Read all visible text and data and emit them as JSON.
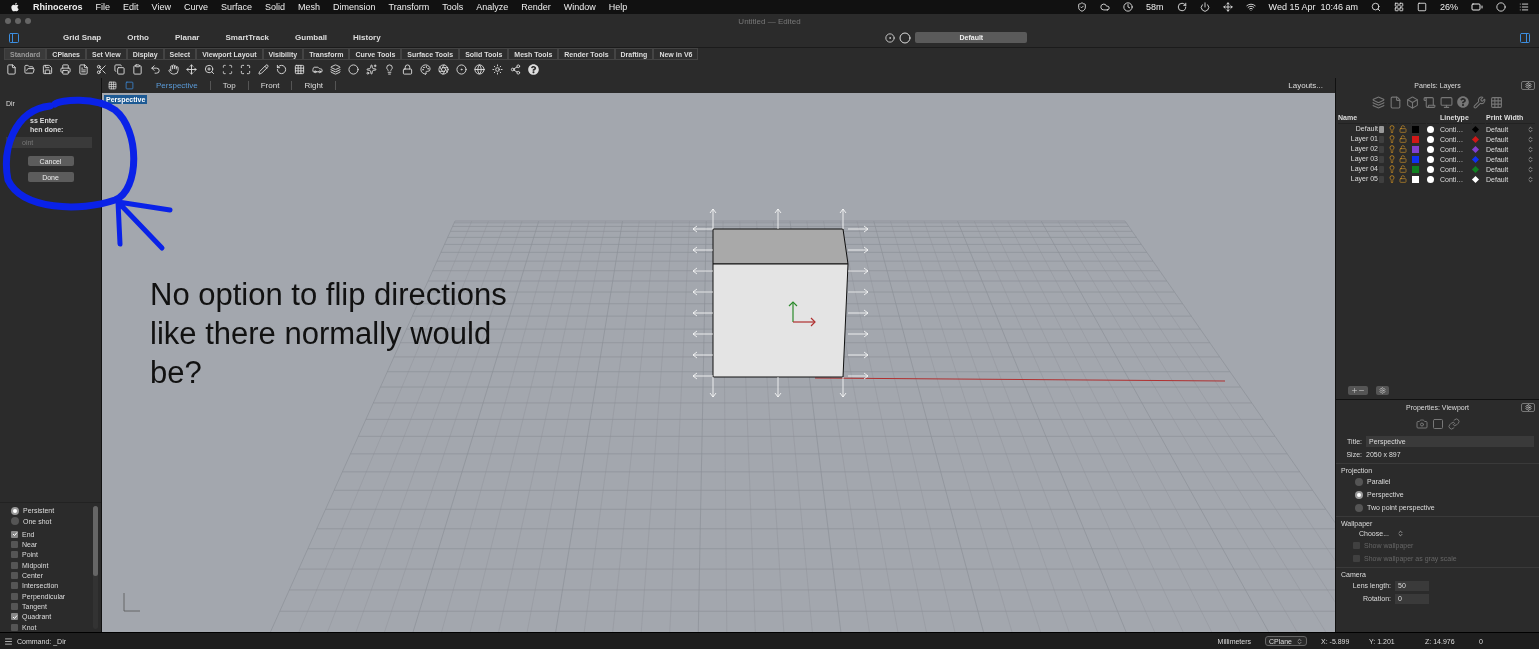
{
  "menu_bar": {
    "app": "Rhinoceros",
    "items": [
      "File",
      "Edit",
      "View",
      "Curve",
      "Surface",
      "Solid",
      "Mesh",
      "Dimension",
      "Transform",
      "Tools",
      "Analyze",
      "Render",
      "Window",
      "Help"
    ],
    "timer": "58m",
    "datetime": "Wed 15 Apr  10:46 am",
    "battery": "26%"
  },
  "window": {
    "title": "Untitled — Edited"
  },
  "modes": [
    "Grid Snap",
    "Ortho",
    "Planar",
    "SmartTrack",
    "Gumball",
    "History"
  ],
  "layer_field": "Default",
  "toolbar_tabs": [
    {
      "label": "Standard",
      "selected": true
    },
    {
      "label": "CPlanes",
      "selected": false
    },
    {
      "label": "Set View",
      "selected": false
    },
    {
      "label": "Display",
      "selected": false
    },
    {
      "label": "Select",
      "selected": false
    },
    {
      "label": "Viewport Layout",
      "selected": false
    },
    {
      "label": "Visibility",
      "selected": false
    },
    {
      "label": "Transform",
      "selected": false
    },
    {
      "label": "Curve Tools",
      "selected": false
    },
    {
      "label": "Surface Tools",
      "selected": false
    },
    {
      "label": "Solid Tools",
      "selected": false
    },
    {
      "label": "Mesh Tools",
      "selected": false
    },
    {
      "label": "Render Tools",
      "selected": false
    },
    {
      "label": "Drafting",
      "selected": false
    },
    {
      "label": "New in V6",
      "selected": false
    }
  ],
  "viewport_tabs": [
    {
      "label": "Perspective",
      "selected": true
    },
    {
      "label": "Top",
      "selected": false
    },
    {
      "label": "Front",
      "selected": false
    },
    {
      "label": "Right",
      "selected": false
    }
  ],
  "layouts_button": "Layouts...",
  "viewport": {
    "label": "Perspective"
  },
  "command_panel": {
    "title": "Dir",
    "prompt": [
      "ss Enter",
      "hen done:"
    ],
    "input": {
      "placeholder": "oint"
    },
    "buttons": [
      "Cancel",
      "Done"
    ]
  },
  "osnap": {
    "modes": [
      {
        "label": "Persistent",
        "selected": true
      },
      {
        "label": "One shot",
        "selected": false
      }
    ],
    "snaps": [
      {
        "label": "End",
        "checked": true
      },
      {
        "label": "Near",
        "checked": false
      },
      {
        "label": "Point",
        "checked": false
      },
      {
        "label": "Midpoint",
        "checked": false
      },
      {
        "label": "Center",
        "checked": false
      },
      {
        "label": "Intersection",
        "checked": false
      },
      {
        "label": "Perpendicular",
        "checked": false
      },
      {
        "label": "Tangent",
        "checked": false
      },
      {
        "label": "Quadrant",
        "checked": true
      },
      {
        "label": "Knot",
        "checked": false
      }
    ]
  },
  "annotation": {
    "text": "No option to flip directions like there normally would be?"
  },
  "layers_panel": {
    "title": "Panels: Layers",
    "columns": [
      "Name",
      "Linetype",
      "Print Width"
    ],
    "rows": [
      {
        "name": "Default",
        "current": true,
        "color": "#000000",
        "linetype": "Conti…",
        "print_width": "Default"
      },
      {
        "name": "Layer 01",
        "current": false,
        "color": "#d01818",
        "linetype": "Conti…",
        "print_width": "Default"
      },
      {
        "name": "Layer 02",
        "current": false,
        "color": "#8040d0",
        "linetype": "Conti…",
        "print_width": "Default"
      },
      {
        "name": "Layer 03",
        "current": false,
        "color": "#1030f0",
        "linetype": "Conti…",
        "print_width": "Default"
      },
      {
        "name": "Layer 04",
        "current": false,
        "color": "#108020",
        "linetype": "Conti…",
        "print_width": "Default"
      },
      {
        "name": "Layer 05",
        "current": false,
        "color": "#ffffff",
        "linetype": "Conti…",
        "print_width": "Default"
      }
    ]
  },
  "properties_panel": {
    "title": "Properties: Viewport",
    "fields": [
      {
        "label": "Title:",
        "value": "Perspective",
        "kind": "input"
      },
      {
        "label": "Size:",
        "value": "2050 x 897",
        "kind": "text"
      }
    ],
    "projection": {
      "heading": "Projection",
      "options": [
        {
          "label": "Parallel",
          "selected": false
        },
        {
          "label": "Perspective",
          "selected": true
        },
        {
          "label": "Two point perspective",
          "selected": false
        }
      ]
    },
    "wallpaper": {
      "heading": "Wallpaper",
      "select": "Choose...",
      "options": [
        {
          "label": "Show wallpaper",
          "checked": false,
          "disabled": true
        },
        {
          "label": "Show wallpaper as gray scale",
          "checked": false,
          "disabled": true
        }
      ]
    },
    "camera": {
      "heading": "Camera",
      "fields": [
        {
          "label": "Lens length:",
          "value": "50"
        },
        {
          "label": "Rotation:",
          "value": "0"
        }
      ]
    }
  },
  "status_bar": {
    "command": "Command: _Dir",
    "units": "Millimeters",
    "cplane": "CPlane",
    "x": "X: -5.899",
    "y": "Y: 1.201",
    "z": "Z: 14.976",
    "value": "0"
  }
}
